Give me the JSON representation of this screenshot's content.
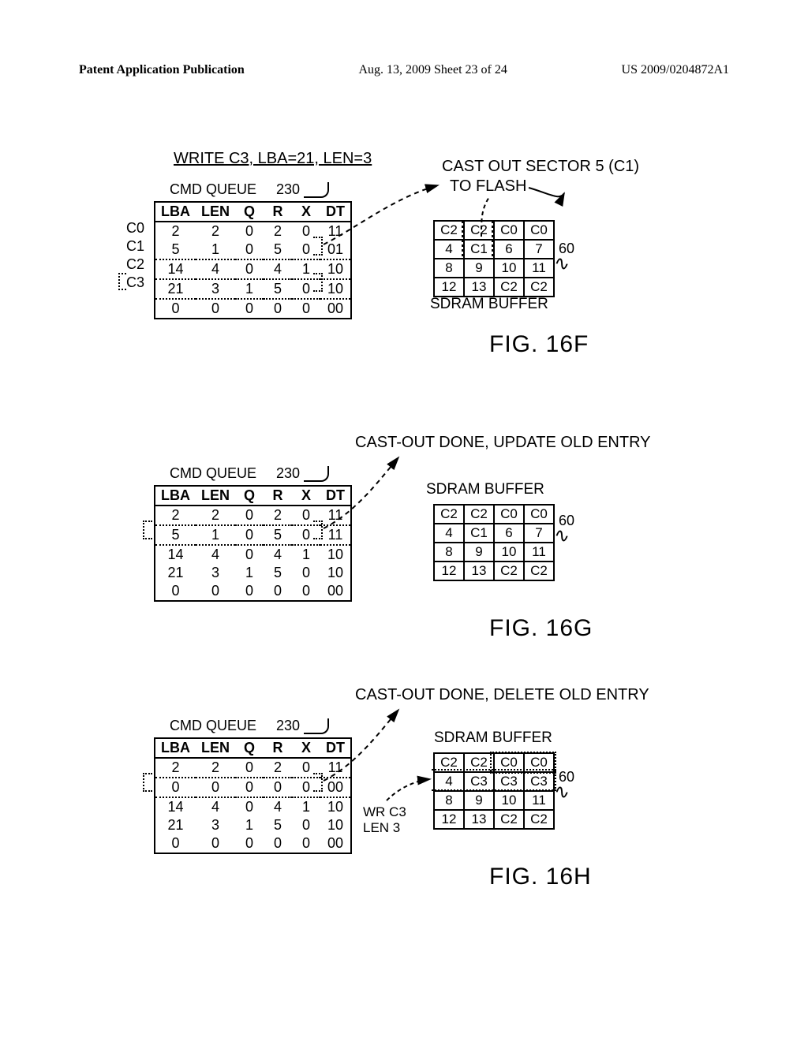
{
  "doc_header": {
    "left": "Patent Application Publication",
    "mid": "Aug. 13, 2009  Sheet 23 of 24",
    "right": "US 2009/0204872A1"
  },
  "figF": {
    "op_title": "WRITE C3, LBA=21, LEN=3",
    "castout": "CAST OUT SECTOR 5 (C1)",
    "to_flash": "TO FLASH",
    "cmd_queue_label": "CMD QUEUE",
    "ref230": "230",
    "headers": [
      "LBA",
      "LEN",
      "Q",
      "R",
      "X",
      "DT"
    ],
    "row_labels": [
      "C0",
      "C1",
      "C2",
      "C3"
    ],
    "rows": [
      [
        "2",
        "2",
        "0",
        "2",
        "0",
        "11"
      ],
      [
        "5",
        "1",
        "0",
        "5",
        "0",
        "01"
      ],
      [
        "14",
        "4",
        "0",
        "4",
        "1",
        "10"
      ],
      [
        "21",
        "3",
        "1",
        "5",
        "0",
        "10"
      ],
      [
        "0",
        "0",
        "0",
        "0",
        "0",
        "00"
      ]
    ],
    "sdram_label": "SDRAM BUFFER",
    "buf_cells": [
      "C2",
      "C2",
      "C0",
      "C0",
      "4",
      "C1",
      "6",
      "7",
      "8",
      "9",
      "10",
      "11",
      "12",
      "13",
      "C2",
      "C2"
    ],
    "sixty": "60",
    "fig_label": "FIG. 16F"
  },
  "figG": {
    "caption": "CAST-OUT DONE, UPDATE OLD ENTRY",
    "cmd_queue_label": "CMD QUEUE",
    "ref230": "230",
    "headers": [
      "LBA",
      "LEN",
      "Q",
      "R",
      "X",
      "DT"
    ],
    "rows": [
      [
        "2",
        "2",
        "0",
        "2",
        "0",
        "11"
      ],
      [
        "5",
        "1",
        "0",
        "5",
        "0",
        "11"
      ],
      [
        "14",
        "4",
        "0",
        "4",
        "1",
        "10"
      ],
      [
        "21",
        "3",
        "1",
        "5",
        "0",
        "10"
      ],
      [
        "0",
        "0",
        "0",
        "0",
        "0",
        "00"
      ]
    ],
    "sdram_label": "SDRAM BUFFER",
    "buf_cells": [
      "C2",
      "C2",
      "C0",
      "C0",
      "4",
      "C1",
      "6",
      "7",
      "8",
      "9",
      "10",
      "11",
      "12",
      "13",
      "C2",
      "C2"
    ],
    "sixty": "60",
    "fig_label": "FIG. 16G"
  },
  "figH": {
    "caption": "CAST-OUT DONE, DELETE OLD ENTRY",
    "cmd_queue_label": "CMD QUEUE",
    "ref230": "230",
    "headers": [
      "LBA",
      "LEN",
      "Q",
      "R",
      "X",
      "DT"
    ],
    "rows": [
      [
        "2",
        "2",
        "0",
        "2",
        "0",
        "11"
      ],
      [
        "0",
        "0",
        "0",
        "0",
        "0",
        "00"
      ],
      [
        "14",
        "4",
        "0",
        "4",
        "1",
        "10"
      ],
      [
        "21",
        "3",
        "1",
        "5",
        "0",
        "10"
      ],
      [
        "0",
        "0",
        "0",
        "0",
        "0",
        "00"
      ]
    ],
    "sdram_label": "SDRAM BUFFER",
    "buf_cells": [
      "C2",
      "C2",
      "C0",
      "C0",
      "4",
      "C3",
      "C3",
      "C3",
      "8",
      "9",
      "10",
      "11",
      "12",
      "13",
      "C2",
      "C2"
    ],
    "wr_label1": "WR C3",
    "wr_label2": "LEN 3",
    "sixty": "60",
    "fig_label": "FIG. 16H"
  }
}
